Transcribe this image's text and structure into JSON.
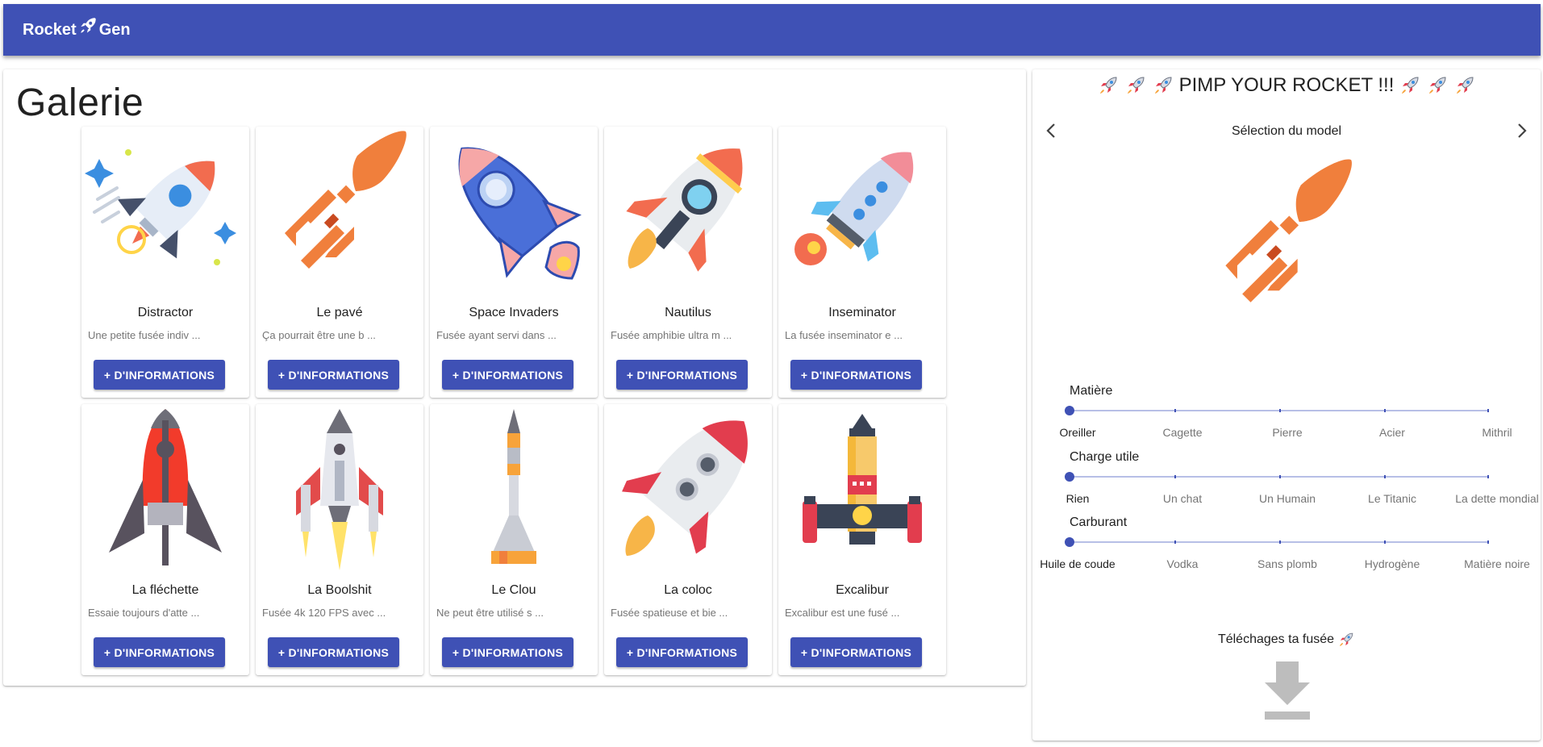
{
  "appbar": {
    "brand_left": "Rocket",
    "brand_right": "Gen"
  },
  "gallery": {
    "title": "Galerie",
    "button_label": "+ D'INFORMATIONS",
    "rockets": [
      {
        "name": "Distractor",
        "desc": "Une petite fusée indiv ...",
        "icon": "distractor-rocket"
      },
      {
        "name": "Le pavé",
        "desc": "Ça pourrait être une b ...",
        "icon": "pave-rocket"
      },
      {
        "name": "Space Invaders",
        "desc": "Fusée ayant servi dans ...",
        "icon": "space-invaders-rocket"
      },
      {
        "name": "Nautilus",
        "desc": "Fusée amphibie ultra m ...",
        "icon": "nautilus-rocket"
      },
      {
        "name": "Inseminator",
        "desc": "La fusée inseminator e ...",
        "icon": "inseminator-rocket"
      },
      {
        "name": "La fléchette",
        "desc": "Essaie toujours d'atte ...",
        "icon": "flechette-rocket"
      },
      {
        "name": "La Boolshit",
        "desc": "Fusée 4k 120 FPS avec ...",
        "icon": "boolshit-rocket"
      },
      {
        "name": "Le Clou",
        "desc": "Ne peut être utilisé s ...",
        "icon": "clou-rocket"
      },
      {
        "name": "La coloc",
        "desc": "Fusée spatieuse et bie ...",
        "icon": "coloc-rocket"
      },
      {
        "name": "Excalibur",
        "desc": "Excalibur est une fusé ...",
        "icon": "excalibur-rocket"
      }
    ]
  },
  "customizer": {
    "title": "PIMP YOUR ROCKET !!!",
    "model_label": "Sélection du model",
    "sliders": [
      {
        "label": "Matière",
        "value_index": 0,
        "marks": [
          "Oreiller",
          "Cagette",
          "Pierre",
          "Acier",
          "Mithril"
        ]
      },
      {
        "label": "Charge utile",
        "value_index": 0,
        "marks": [
          "Rien",
          "Un chat",
          "Un Humain",
          "Le Titanic",
          "La dette mondial"
        ]
      },
      {
        "label": "Carburant",
        "value_index": 0,
        "marks": [
          "Huile de coude",
          "Vodka",
          "Sans plomb",
          "Hydrogène",
          "Matière noire"
        ]
      }
    ],
    "download_label": "Téléchages ta fusée"
  },
  "colors": {
    "primary": "#3f51b5",
    "orange": "#f07f3c",
    "red": "#e23d4e",
    "blue": "#4a6fd8"
  }
}
